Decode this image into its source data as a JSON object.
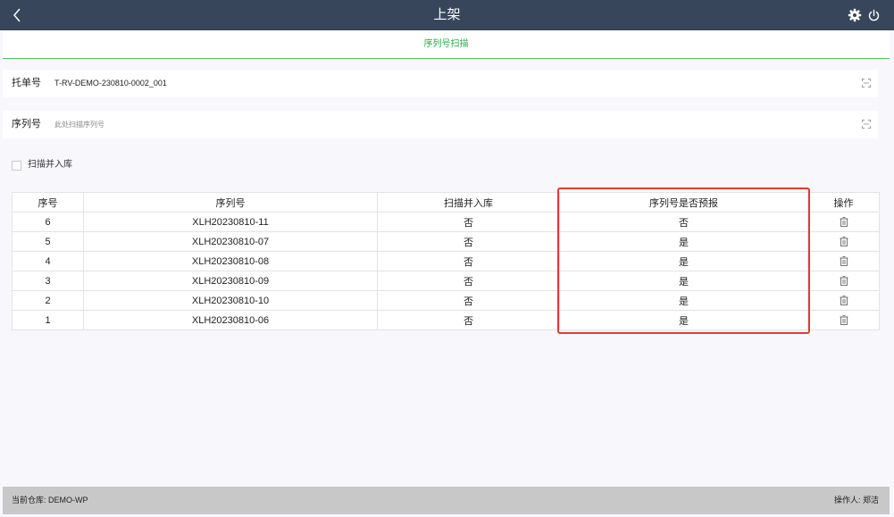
{
  "header": {
    "title": "上架",
    "back_icon": "chevron-left-icon",
    "settings_icon": "gear-icon",
    "power_icon": "power-icon",
    "background": "#37465a"
  },
  "subtitle": {
    "text": "序列号扫描",
    "color": "#22aa44"
  },
  "form": {
    "tray": {
      "label": "托单号",
      "value": "T-RV-DEMO-230810-0002_001"
    },
    "serial": {
      "label": "序列号",
      "placeholder": "此处扫描序列号",
      "value": ""
    },
    "scan_checkbox": {
      "label": "扫描并入库",
      "checked": false
    }
  },
  "table": {
    "headers": [
      "序号",
      "序列号",
      "扫描并入库",
      "序列号是否预报",
      "操作"
    ],
    "rows": [
      {
        "index": "6",
        "serial": "XLH20230810-11",
        "scanned": "否",
        "forecast": "否"
      },
      {
        "index": "5",
        "serial": "XLH20230810-07",
        "scanned": "否",
        "forecast": "是"
      },
      {
        "index": "4",
        "serial": "XLH20230810-08",
        "scanned": "否",
        "forecast": "是"
      },
      {
        "index": "3",
        "serial": "XLH20230810-09",
        "scanned": "否",
        "forecast": "是"
      },
      {
        "index": "2",
        "serial": "XLH20230810-10",
        "scanned": "否",
        "forecast": "是"
      },
      {
        "index": "1",
        "serial": "XLH20230810-06",
        "scanned": "否",
        "forecast": "是"
      }
    ],
    "action_icon": "trash-icon",
    "highlight_color": "#e53935"
  },
  "footer": {
    "warehouse": "当前仓库: DEMO-WP",
    "operator": "操作人: 郑洁"
  }
}
